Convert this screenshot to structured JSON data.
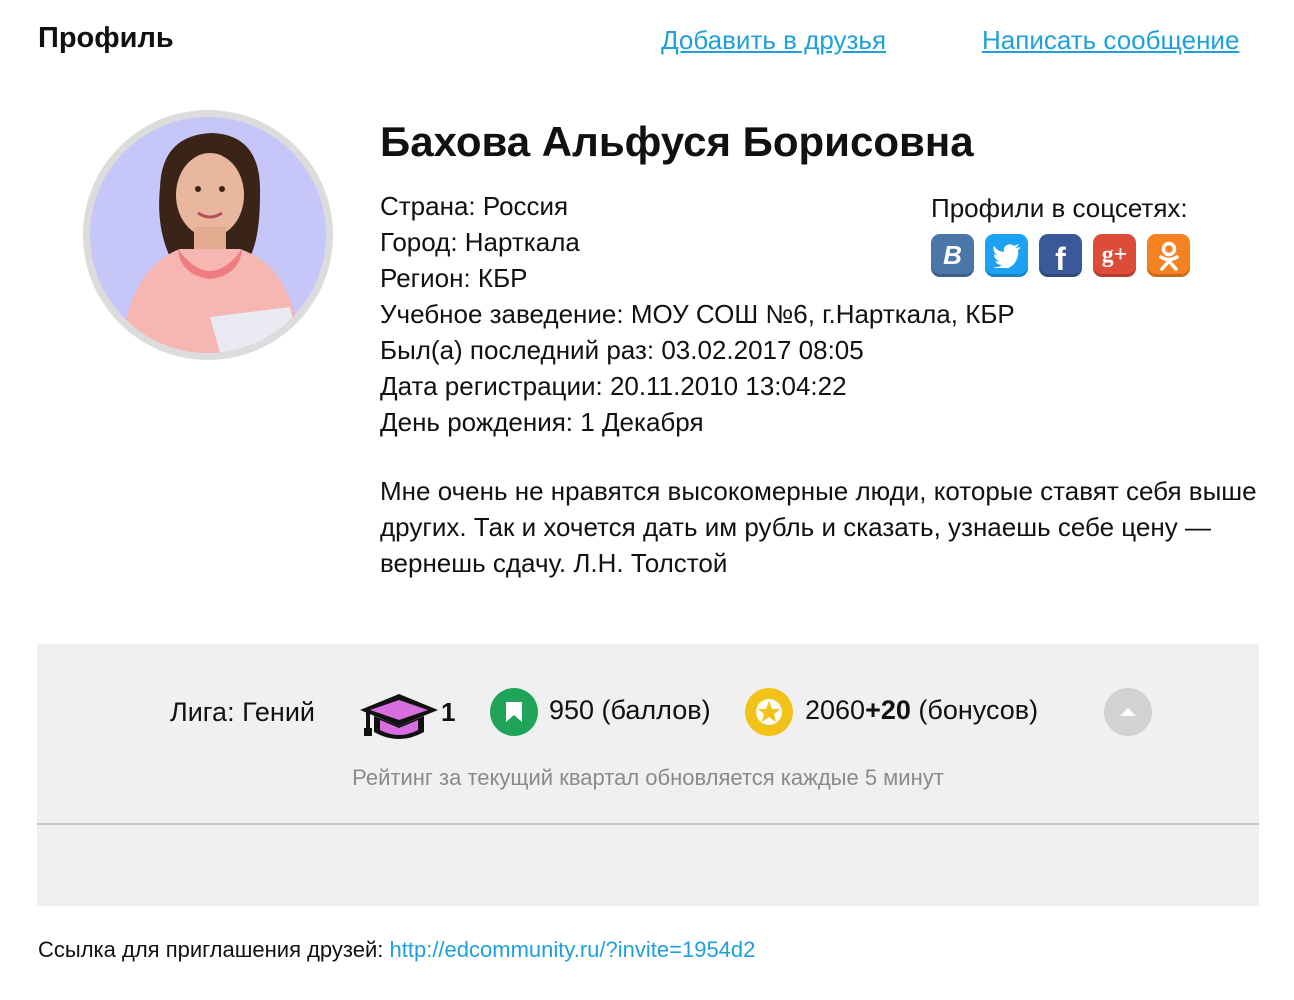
{
  "header": {
    "title": "Профиль",
    "add_friend": "Добавить в друзья",
    "send_message": "Написать сообщение"
  },
  "profile": {
    "name": "Бахова Альфуся Борисовна",
    "country": "Страна: Россия",
    "city": "Город: Нарткала",
    "region": "Регион: КБР",
    "school": "Учебное заведение: МОУ СОШ №6, г.Нарткала, КБР",
    "last_seen": "Был(а) последний раз: 03.02.2017 08:05",
    "registered": "Дата регистрации: 20.11.2010 13:04:22",
    "birthday": "День рождения: 1 Декабря",
    "quote": "Мне очень не нравятся высокомерные люди, которые ставят себя выше других. Так и хочется дать им рубль и сказать, узнаешь себе цену — вернешь сдачу. Л.Н. Толстой"
  },
  "social": {
    "title": "Профили в соцсетях:",
    "items": [
      {
        "icon": "vk-icon",
        "glyph": "B",
        "color": "#4a76a8"
      },
      {
        "icon": "twitter-icon",
        "glyph": "t",
        "color": "#1da1f2"
      },
      {
        "icon": "facebook-icon",
        "glyph": "f",
        "color": "#3b5998"
      },
      {
        "icon": "google-plus-icon",
        "glyph": "g+",
        "color": "#dd4b39"
      },
      {
        "icon": "odnoklassniki-icon",
        "glyph": "ok",
        "color": "#f58220"
      }
    ]
  },
  "stats": {
    "league": "Лига: Гений",
    "cap_count": "1",
    "points": "950 (баллов)",
    "bonus_base": "2060",
    "bonus_extra": "+20",
    "bonus_suffix": " (бонусов)",
    "rating_note": "Рейтинг за текущий квартал обновляется каждые 5 минут"
  },
  "invite": {
    "label": "Ссылка для приглашения друзей: ",
    "url": "http://edcommunity.ru/?invite=1954d2"
  }
}
